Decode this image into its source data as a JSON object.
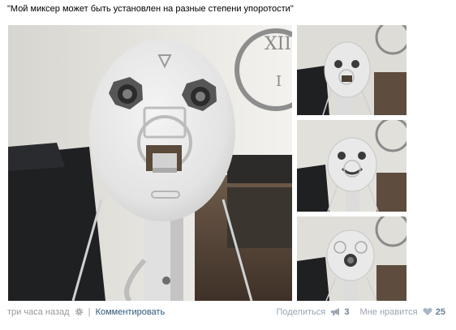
{
  "post": {
    "caption": "\"Мой миксер может быть установлен на разные степени упоротости\"",
    "time": "три часа назад",
    "separator": "|",
    "comment_link": "Комментировать",
    "share_label": "Поделиться",
    "share_count": "3",
    "like_label": "Мне нравится",
    "like_count": "25"
  },
  "icons": {
    "settings": "gear-icon",
    "share": "megaphone-icon",
    "like": "heart-icon"
  },
  "colors": {
    "link": "#2b587a",
    "muted": "#999999",
    "counter": "#6a7f95"
  }
}
